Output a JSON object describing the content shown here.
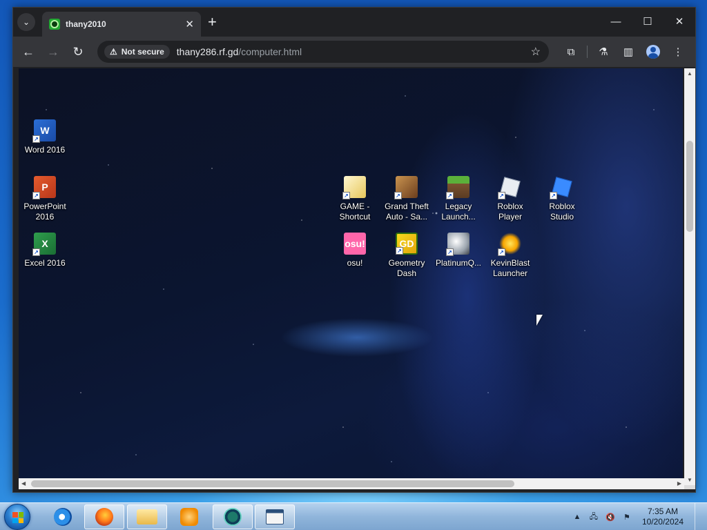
{
  "browser": {
    "tab_title": "thany2010",
    "security_label": "Not secure",
    "url_host": "thany286.rf.gd",
    "url_path": "/computer.html"
  },
  "web_desktop": {
    "icons": [
      {
        "label": "Word 2016",
        "abbr": "W"
      },
      {
        "label": "PowerPoint\n2016",
        "abbr": "P"
      },
      {
        "label": "Excel 2016",
        "abbr": "X"
      },
      {
        "label": "GAME -\nShortcut",
        "abbr": ""
      },
      {
        "label": "Grand Theft\nAuto - Sa...",
        "abbr": ""
      },
      {
        "label": "Legacy\nLaunch...",
        "abbr": ""
      },
      {
        "label": "Roblox\nPlayer",
        "abbr": ""
      },
      {
        "label": "Roblox\nStudio",
        "abbr": ""
      },
      {
        "label": "osu!",
        "abbr": "osu!"
      },
      {
        "label": "Geometry\nDash",
        "abbr": "GD"
      },
      {
        "label": "PlatinumQ...",
        "abbr": ""
      },
      {
        "label": "KevinBlast\nLauncher",
        "abbr": ""
      }
    ]
  },
  "taskbar": {
    "time": "7:35 AM",
    "date": "10/20/2024"
  }
}
